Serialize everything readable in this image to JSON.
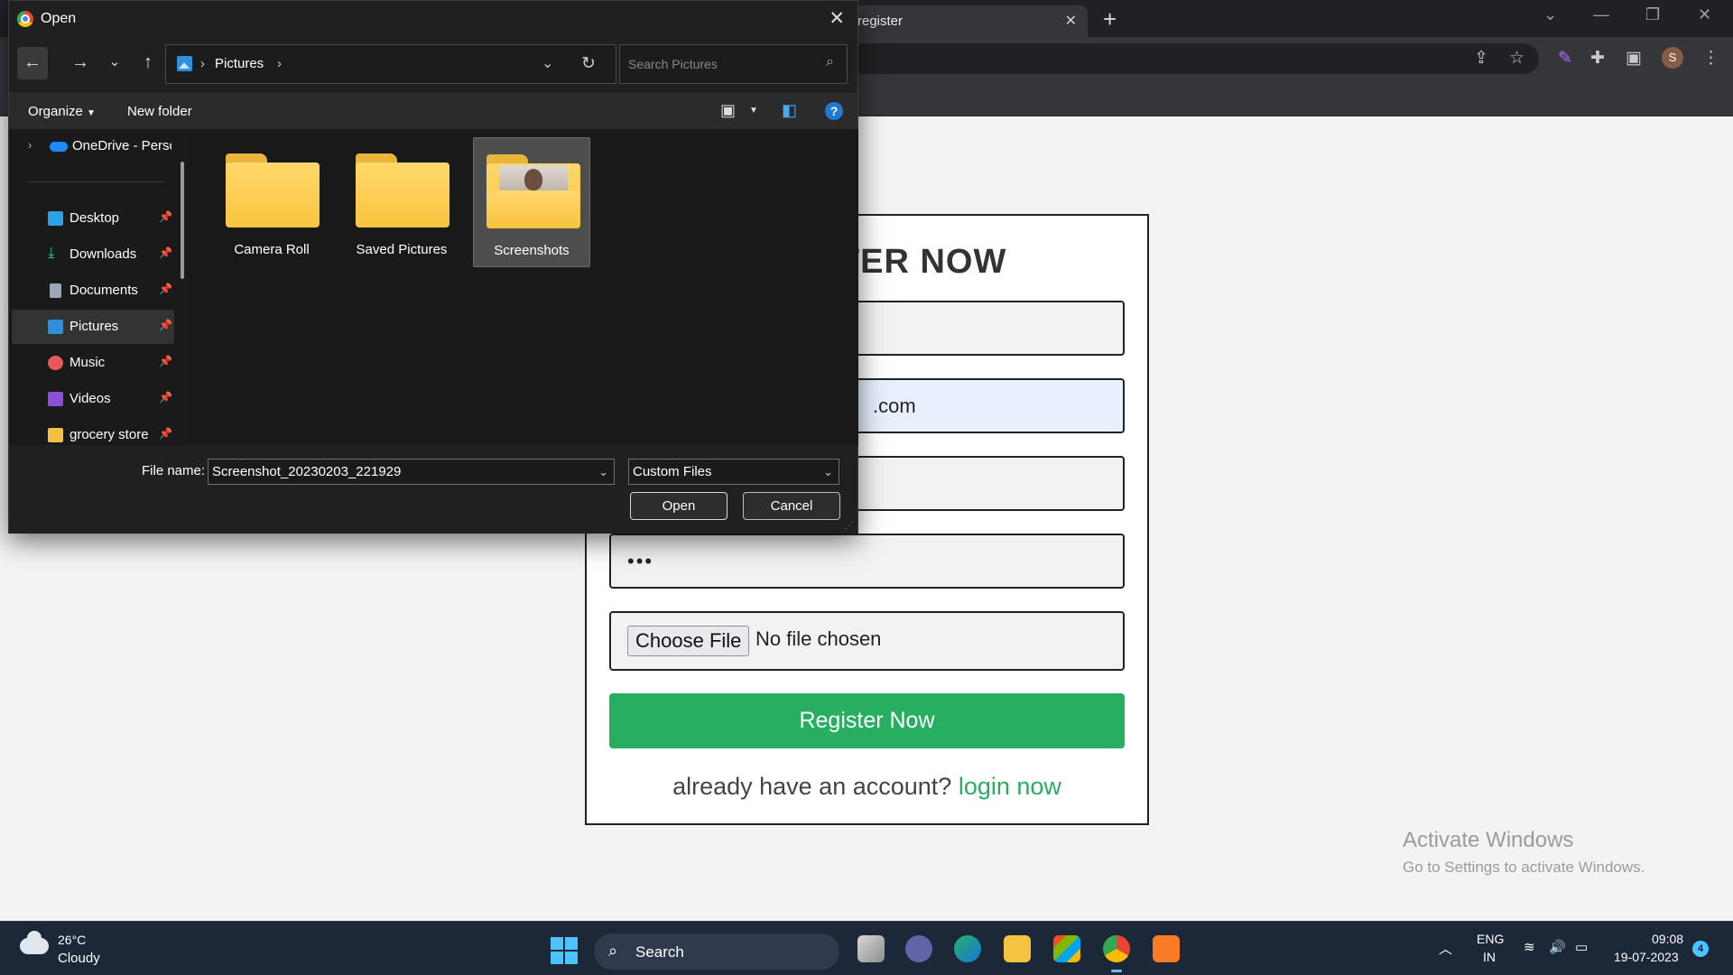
{
  "browser": {
    "tab_title": "register",
    "tab_close": "✕",
    "new_tab": "+",
    "profile_initial": "S"
  },
  "register_form": {
    "title": "REGISTER NOW",
    "title_visible": "TER NOW",
    "email_visible": ".com",
    "password_mask": "•••",
    "choose_file": "Choose File",
    "no_file": "No file chosen",
    "submit": "Register Now",
    "login_prompt": "already have an account?",
    "login_link": "login now"
  },
  "watermark": {
    "title": "Activate Windows",
    "subtitle": "Go to Settings to activate Windows."
  },
  "dialog": {
    "title": "Open",
    "address": "Pictures",
    "search_placeholder": "Search Pictures",
    "organize": "Organize",
    "new_folder": "New folder",
    "nav_items": [
      {
        "label": "OneDrive - Perso",
        "icon": "cloud-icon"
      },
      {
        "label": "Desktop",
        "icon": "desktop-icon"
      },
      {
        "label": "Downloads",
        "icon": "download-icon"
      },
      {
        "label": "Documents",
        "icon": "document-icon"
      },
      {
        "label": "Pictures",
        "icon": "pictures-icon"
      },
      {
        "label": "Music",
        "icon": "music-icon"
      },
      {
        "label": "Videos",
        "icon": "videos-icon"
      },
      {
        "label": "grocery store",
        "icon": "folder-icon"
      }
    ],
    "folders": [
      "Camera Roll",
      "Saved Pictures",
      "Screenshots"
    ],
    "selected_folder": "Screenshots",
    "file_name_label": "File name:",
    "file_name_value": "Screenshot_20230203_221929",
    "file_type": "Custom Files",
    "open_button": "Open",
    "cancel_button": "Cancel"
  },
  "taskbar": {
    "temperature": "26°C",
    "weather": "Cloudy",
    "search_label": "Search",
    "lang_line1": "ENG",
    "lang_line2": "IN",
    "time": "09:08",
    "date": "19-07-2023",
    "notifications": "4"
  },
  "colors": {
    "accent_green": "#27ae60",
    "dialog_bg": "#202020",
    "taskbar_bg": "#1c2738"
  }
}
